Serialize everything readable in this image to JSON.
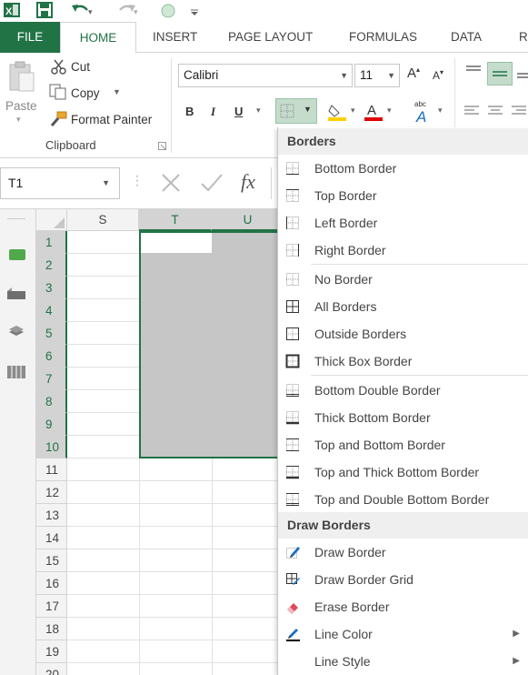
{
  "app": {
    "accent": "#217346"
  },
  "tabs": [
    "FILE",
    "HOME",
    "INSERT",
    "PAGE LAYOUT",
    "FORMULAS",
    "DATA",
    "R"
  ],
  "clipboard": {
    "paste": "Paste",
    "cut": "Cut",
    "copy": "Copy",
    "format_painter": "Format Painter",
    "group_label": "Clipboard"
  },
  "font": {
    "name": "Calibri",
    "size": "11",
    "bold": "B",
    "italic": "I",
    "underline": "U"
  },
  "formula_bar": {
    "name_box": "T1",
    "fx": "fx",
    "value": ""
  },
  "sheet": {
    "columns": [
      "S",
      "T",
      "U"
    ],
    "rows": [
      "1",
      "2",
      "3",
      "4",
      "5",
      "6",
      "7",
      "8",
      "9",
      "10",
      "11",
      "12",
      "13",
      "14",
      "15",
      "16",
      "17",
      "18",
      "19",
      "20"
    ],
    "selected_range": "T1:U10",
    "active_cell": "T1"
  },
  "menu": {
    "header_borders": "Borders",
    "items_borders": [
      {
        "label": "Bottom Border",
        "icon": "bottom-border-icon"
      },
      {
        "label": "Top Border",
        "icon": "top-border-icon"
      },
      {
        "label": "Left Border",
        "icon": "left-border-icon"
      },
      {
        "label": "Right Border",
        "icon": "right-border-icon"
      },
      {
        "label": "No Border",
        "icon": "no-border-icon"
      },
      {
        "label": "All Borders",
        "icon": "all-borders-icon"
      },
      {
        "label": "Outside Borders",
        "icon": "outside-borders-icon"
      },
      {
        "label": "Thick Box Border",
        "icon": "thick-box-border-icon"
      },
      {
        "label": "Bottom Double Border",
        "icon": "bottom-double-border-icon"
      },
      {
        "label": "Thick Bottom Border",
        "icon": "thick-bottom-border-icon"
      },
      {
        "label": "Top and Bottom Border",
        "icon": "top-bottom-border-icon"
      },
      {
        "label": "Top and Thick Bottom Border",
        "icon": "top-thick-bottom-border-icon"
      },
      {
        "label": "Top and Double Bottom Border",
        "icon": "top-double-bottom-border-icon"
      }
    ],
    "header_draw": "Draw Borders",
    "items_draw": [
      {
        "label": "Draw Border",
        "icon": "draw-border-icon"
      },
      {
        "label": "Draw Border Grid",
        "icon": "draw-border-grid-icon"
      },
      {
        "label": "Erase Border",
        "icon": "eraser-icon"
      },
      {
        "label": "Line Color",
        "icon": "line-color-icon"
      },
      {
        "label": "Line Style",
        "icon": "line-style-icon"
      }
    ]
  }
}
